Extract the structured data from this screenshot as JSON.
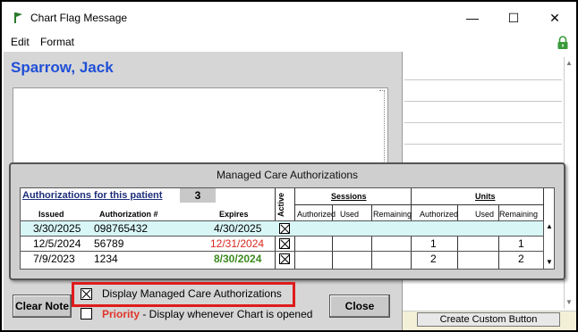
{
  "window": {
    "title": "Chart Flag Message",
    "controls": {
      "minimize": "—",
      "maximize": "☐",
      "close": "✕"
    }
  },
  "menu": {
    "items": [
      "Edit",
      "Format"
    ]
  },
  "patient": {
    "name": "Sparrow, Jack"
  },
  "right_panel": {
    "custom_button_label": "Create Custom Button"
  },
  "mca": {
    "title": "Managed Care Authorizations",
    "auth_label": "Authorizations for this patient",
    "count": "3",
    "headers": {
      "issued": "Issued",
      "authorization": "Authorization #",
      "expires": "Expires",
      "active": "Active",
      "sessions": "Sessions",
      "units": "Units",
      "authorized": "Authorized",
      "used": "Used",
      "remaining": "Remaining"
    },
    "rows": [
      {
        "issued": "3/30/2025",
        "auth": "098765432",
        "expires": "4/30/2025",
        "expires_color": "#000000",
        "active": true,
        "s_auth": "",
        "s_used": "",
        "s_rem": "",
        "u_auth": "",
        "u_used": "",
        "u_rem": ""
      },
      {
        "issued": "12/5/2024",
        "auth": "56789",
        "expires": "12/31/2024",
        "expires_color": "#d9291f",
        "active": true,
        "s_auth": "",
        "s_used": "",
        "s_rem": "",
        "u_auth": "1",
        "u_used": "",
        "u_rem": "1"
      },
      {
        "issued": "7/9/2023",
        "auth": "1234",
        "expires": "8/30/2024",
        "expires_color": "#3c8a1f",
        "active": true,
        "s_auth": "",
        "s_used": "",
        "s_rem": "",
        "u_auth": "2",
        "u_used": "",
        "u_rem": "2"
      }
    ]
  },
  "controls": {
    "clear_note": "Clear Note",
    "close": "Close",
    "display_mca_label": "Display Managed Care Authorizations",
    "display_mca_checked": true,
    "priority_label": "Priority",
    "priority_desc": " - Display whenever Chart is opened",
    "priority_checked": false
  },
  "colors": {
    "patient_name": "#1f4fd6",
    "first_row_bg": "#d9f6f6",
    "highlight_border": "#e01b1b",
    "priority_text": "#e0352b"
  }
}
